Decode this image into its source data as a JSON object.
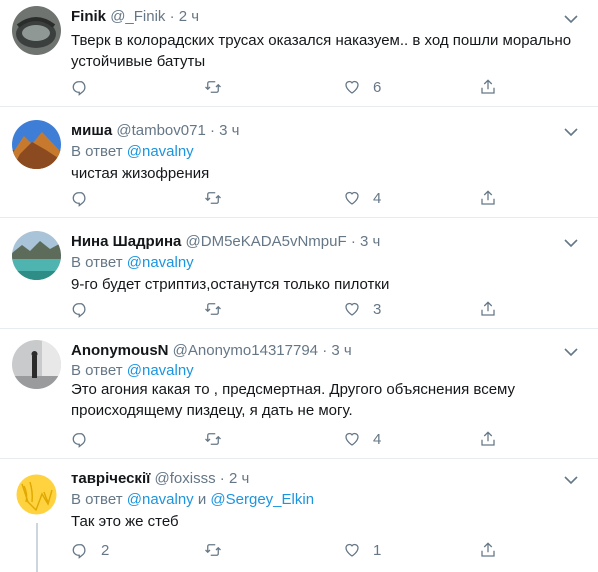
{
  "tweets": [
    {
      "name": "Finik",
      "handle": "@_Finik",
      "time": "2 ч",
      "reply_to": [],
      "text": "Тверк в колорадских трусах оказался наказуем.. в ход пошли морально устойчивые батуты",
      "replies": "",
      "retweets": "",
      "likes": "6"
    },
    {
      "name": "миша",
      "handle": "@tambov071",
      "time": "3 ч",
      "reply_prefix": "В ответ",
      "reply_to": [
        "@navalny"
      ],
      "text": "чистая жизофрения",
      "replies": "",
      "retweets": "",
      "likes": "4"
    },
    {
      "name": "Нина Шадрина",
      "handle": "@DM5eKADA5vNmpuF",
      "time": "3 ч",
      "reply_prefix": "В ответ",
      "reply_to": [
        "@navalny"
      ],
      "text": "9-го будет стриптиз,останутся только пилотки",
      "replies": "",
      "retweets": "",
      "likes": "3"
    },
    {
      "name": "AnonymousN",
      "handle": "@Anonymo14317794",
      "time": "3 ч",
      "reply_prefix": "В ответ",
      "reply_to": [
        "@navalny"
      ],
      "text": "Это агония какая то , предсмертная. Другого объяснения всему происходящему пиздецу, я дать не могу.",
      "replies": "",
      "retweets": "",
      "likes": "4"
    },
    {
      "name": "тавріческії",
      "handle": "@foxisss",
      "time": "2 ч",
      "reply_prefix": "В ответ",
      "reply_to": [
        "@navalny",
        "@Sergey_Elkin"
      ],
      "reply_joiner": "и",
      "text": "Так это же стеб",
      "replies": "2",
      "retweets": "",
      "likes": "1"
    }
  ],
  "separator": "·",
  "icons": {
    "reply": "reply-icon",
    "retweet": "retweet-icon",
    "like": "heart-icon",
    "share": "share-icon",
    "more": "chevron-down-icon"
  },
  "colors": {
    "link": "#1b95e0",
    "muted": "#657786",
    "divider": "#e6ecf0"
  }
}
